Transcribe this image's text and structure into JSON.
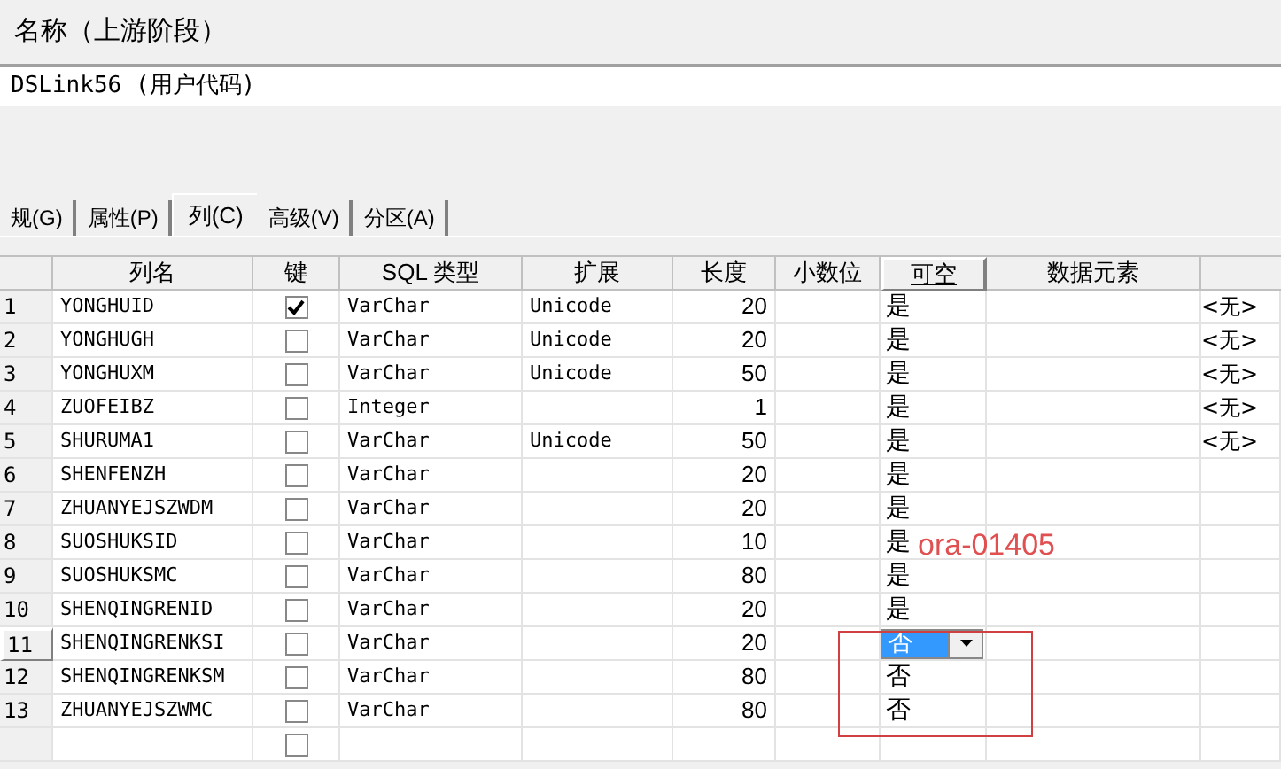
{
  "field_label": "名称（上游阶段）",
  "field_value": "DSLink56 (用户代码)",
  "tabs": [
    {
      "label": "规(G)",
      "selected": false
    },
    {
      "label": "属性(P)",
      "selected": false
    },
    {
      "label": "列(C)",
      "selected": true
    },
    {
      "label": "高级(V)",
      "selected": false
    },
    {
      "label": "分区(A)",
      "selected": false
    }
  ],
  "table": {
    "columns": [
      {
        "label": "列名",
        "selected": false
      },
      {
        "label": "键",
        "selected": false
      },
      {
        "label": "SQL 类型",
        "selected": false
      },
      {
        "label": "扩展",
        "selected": false
      },
      {
        "label": "长度",
        "selected": false
      },
      {
        "label": "小数位",
        "selected": false
      },
      {
        "label": "可空",
        "selected": true
      },
      {
        "label": "数据元素",
        "selected": false
      }
    ],
    "rows": [
      {
        "num": "1",
        "name": "YONGHUID",
        "key": true,
        "sql_type": "VarChar",
        "extension": "Unicode",
        "length": "20",
        "nullable": "是",
        "kind": "text",
        "column_9": "<无>",
        "selected": false
      },
      {
        "num": "2",
        "name": "YONGHUGH",
        "key": false,
        "sql_type": "VarChar",
        "extension": "Unicode",
        "length": "20",
        "nullable": "是",
        "kind": "text",
        "column_9": "<无>",
        "selected": false
      },
      {
        "num": "3",
        "name": "YONGHUXM",
        "key": false,
        "sql_type": "VarChar",
        "extension": "Unicode",
        "length": "50",
        "nullable": "是",
        "kind": "text",
        "column_9": "<无>",
        "selected": false
      },
      {
        "num": "4",
        "name": "ZUOFEIBZ",
        "key": false,
        "sql_type": "Integer",
        "length": "1",
        "nullable": "是",
        "kind": "text",
        "column_9": "<无>",
        "selected": false
      },
      {
        "num": "5",
        "name": "SHURUMA1",
        "key": false,
        "sql_type": "VarChar",
        "extension": "Unicode",
        "length": "50",
        "nullable": "是",
        "kind": "text",
        "column_9": "<无>",
        "selected": false
      },
      {
        "num": "6",
        "name": "SHENFENZH",
        "key": false,
        "sql_type": "VarChar",
        "length": "20",
        "nullable": "是",
        "kind": "text",
        "selected": false
      },
      {
        "num": "7",
        "name": "ZHUANYEJSZWDM",
        "key": false,
        "sql_type": "VarChar",
        "length": "20",
        "nullable": "是",
        "kind": "text",
        "selected": false
      },
      {
        "num": "8",
        "name": "SUOSHUKSID",
        "key": false,
        "sql_type": "VarChar",
        "length": "10",
        "nullable": "是",
        "kind": "text",
        "selected": false
      },
      {
        "num": "9",
        "name": "SUOSHUKSMC",
        "key": false,
        "sql_type": "VarChar",
        "length": "80",
        "nullable": "是",
        "kind": "text",
        "selected": false
      },
      {
        "num": "10",
        "name": "SHENQINGRENID",
        "key": false,
        "sql_type": "VarChar",
        "length": "20",
        "nullable": "是",
        "kind": "text",
        "selected": false
      },
      {
        "num": "11",
        "name": "SHENQINGRENKSI",
        "key": false,
        "sql_type": "VarChar",
        "length": "20",
        "nullable": "否",
        "kind": "dropdown",
        "selected": true
      },
      {
        "num": "12",
        "name": "SHENQINGRENKSM",
        "key": false,
        "sql_type": "VarChar",
        "length": "80",
        "nullable": "否",
        "kind": "text",
        "selected": false
      },
      {
        "num": "13",
        "name": "ZHUANYEJSZWMC",
        "key": false,
        "sql_type": "VarChar",
        "length": "80",
        "nullable": "否",
        "kind": "text",
        "selected": false
      },
      {
        "key": false,
        "kind": "text",
        "selected": false
      }
    ]
  },
  "annotation": {
    "text": "ora-01405"
  }
}
